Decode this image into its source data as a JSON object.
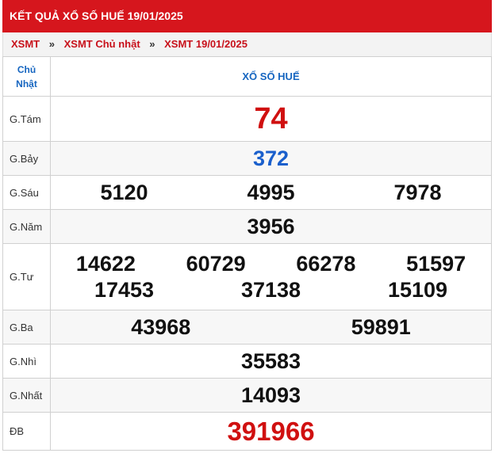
{
  "header": {
    "title": "KẾT QUẢ XỔ SỐ HUẾ 19/01/2025"
  },
  "breadcrumb": [
    "XSMT",
    "XSMT Chủ nhật",
    "XSMT 19/01/2025"
  ],
  "table": {
    "day_label": "Chủ Nhật",
    "province_title": "XỔ SỐ HUẾ",
    "prizes": [
      {
        "label": "G.Tám",
        "numbers": [
          "74"
        ]
      },
      {
        "label": "G.Bảy",
        "numbers": [
          "372"
        ]
      },
      {
        "label": "G.Sáu",
        "numbers": [
          "5120",
          "4995",
          "7978"
        ]
      },
      {
        "label": "G.Năm",
        "numbers": [
          "3956"
        ]
      },
      {
        "label": "G.Tư",
        "numbers": [
          "14622",
          "60729",
          "66278",
          "51597",
          "17453",
          "37138",
          "15109"
        ]
      },
      {
        "label": "G.Ba",
        "numbers": [
          "43968",
          "59891"
        ]
      },
      {
        "label": "G.Nhì",
        "numbers": [
          "35583"
        ]
      },
      {
        "label": "G.Nhất",
        "numbers": [
          "14093"
        ]
      },
      {
        "label": "ĐB",
        "numbers": [
          "391966"
        ]
      }
    ]
  },
  "colors": {
    "header_bg": "#d6161d",
    "link": "#c8101a",
    "title_blue": "#1565c0",
    "special_red": "#d01010",
    "g7_blue": "#1a5fcc"
  }
}
